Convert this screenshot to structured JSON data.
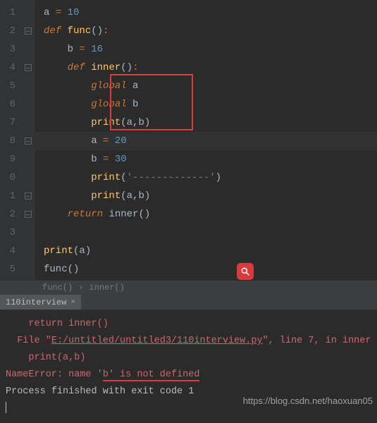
{
  "gutter": [
    "1",
    "2",
    "3",
    "4",
    "5",
    "6",
    "7",
    "8",
    "9",
    "0",
    "1",
    "2",
    "3",
    "4",
    "5"
  ],
  "code": {
    "l1": {
      "a": "a",
      "eq": "=",
      "n": "10"
    },
    "l2": {
      "def": "def",
      "fn": "func",
      "p": "()",
      "c": ":"
    },
    "l3": {
      "b": "b",
      "eq": "=",
      "n": "16"
    },
    "l4": {
      "def": "def",
      "fn": "inner",
      "p": "()",
      "c": ":"
    },
    "l5": {
      "g": "global",
      "v": "a"
    },
    "l6": {
      "g": "global",
      "v": "b"
    },
    "l7": {
      "fn": "print",
      "args": "(a,b)"
    },
    "l8": {
      "v": "a",
      "eq": "=",
      "n": "20"
    },
    "l9": {
      "v": "b",
      "eq": "=",
      "n": "30"
    },
    "l10": {
      "fn": "print",
      "p1": "(",
      "s": "'-------------'",
      "p2": ")"
    },
    "l11": {
      "fn": "print",
      "args": "(a,b)"
    },
    "l12": {
      "ret": "return",
      "fn": "inner",
      "p": "()"
    },
    "l14": {
      "fn": "print",
      "args": "(a)"
    },
    "l15": {
      "fn": "func",
      "p": "()"
    }
  },
  "breadcrumb": {
    "a": "func()",
    "sep": "›",
    "b": "inner()"
  },
  "tab": {
    "name": "110interview",
    "close": "×"
  },
  "console": {
    "ret": "    return inner()",
    "file_pre": "  File \"",
    "file_path": "E:/untitled/untitled3/110interview.py",
    "file_post": "\", line 7, in inner",
    "print": "    print(a,b)",
    "err_pre": "NameError: name '",
    "err_mid": "b' is not defined",
    "blank": "",
    "exit": "Process finished with exit code 1"
  },
  "watermark": "https://blog.csdn.net/haoxuan05"
}
